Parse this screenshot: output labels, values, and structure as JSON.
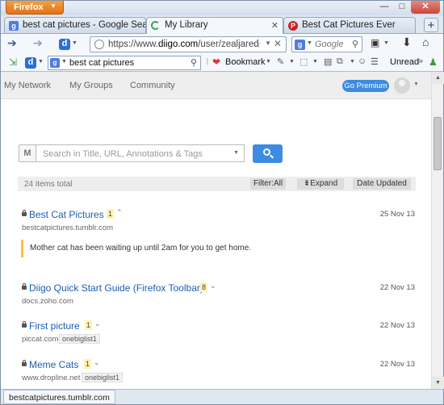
{
  "window": {
    "app_button": "Firefox",
    "controls": {
      "minimize": "—",
      "maximize": "□",
      "close": "✕"
    }
  },
  "tabs": [
    {
      "label": "best cat pictures - Google Search",
      "icon": "google-icon",
      "active": false
    },
    {
      "label": "My Library",
      "icon": "loading-spinner-icon",
      "active": true
    },
    {
      "label": "Best Cat Pictures Ever",
      "icon": "pinterest-icon",
      "active": false
    }
  ],
  "navbar": {
    "url_prefix": "https://www.",
    "url_host": "diigo.com",
    "url_path": "/user/zealjared",
    "search_placeholder": "Google"
  },
  "diigo_toolbar": {
    "search_value": "best cat pictures",
    "bookmark_label": "Bookmark",
    "unread_label": "Unread"
  },
  "diigo_nav": {
    "items": [
      "My Network",
      "My Groups",
      "Community"
    ],
    "premium_label": "Go Premium"
  },
  "library": {
    "search_prefix": "M",
    "search_placeholder": "Search in Title, URL, Annotations & Tags",
    "items_total": "24 items total",
    "filter_label": "Filter:All",
    "expand_label": "Expand",
    "sort_label": "Date Updated"
  },
  "bookmarks": [
    {
      "title": "Best Cat Pictures",
      "count": "1",
      "chevron": "up",
      "date": "25 Nov 13",
      "url": "bestcatpictures.tumblr.com",
      "tags": [],
      "annotation": "Mother cat has been waiting up until 2am for you to get home."
    },
    {
      "title": "Diigo Quick Start Guide (Firefox Toolbar)",
      "count": "8",
      "chevron": "down",
      "date": "22 Nov 13",
      "url": "docs.zoho.com",
      "tags": []
    },
    {
      "title": "First picture",
      "count": "1",
      "chevron": "down",
      "date": "22 Nov 13",
      "url": "piccat.com",
      "tags": [
        "onebiglist1"
      ]
    },
    {
      "title": "Meme Cats",
      "count": "1",
      "chevron": "down",
      "date": "22 Nov 13",
      "url": "www.dropline.net",
      "tags": [
        "onebiglist1"
      ]
    }
  ],
  "status": {
    "text": "bestcatpictures.tumblr.com"
  },
  "colors": {
    "accent": "#3d8be2",
    "link": "#1a5fb4",
    "firefox_orange": "#e2731b",
    "count_badge": "#fff3b0"
  }
}
